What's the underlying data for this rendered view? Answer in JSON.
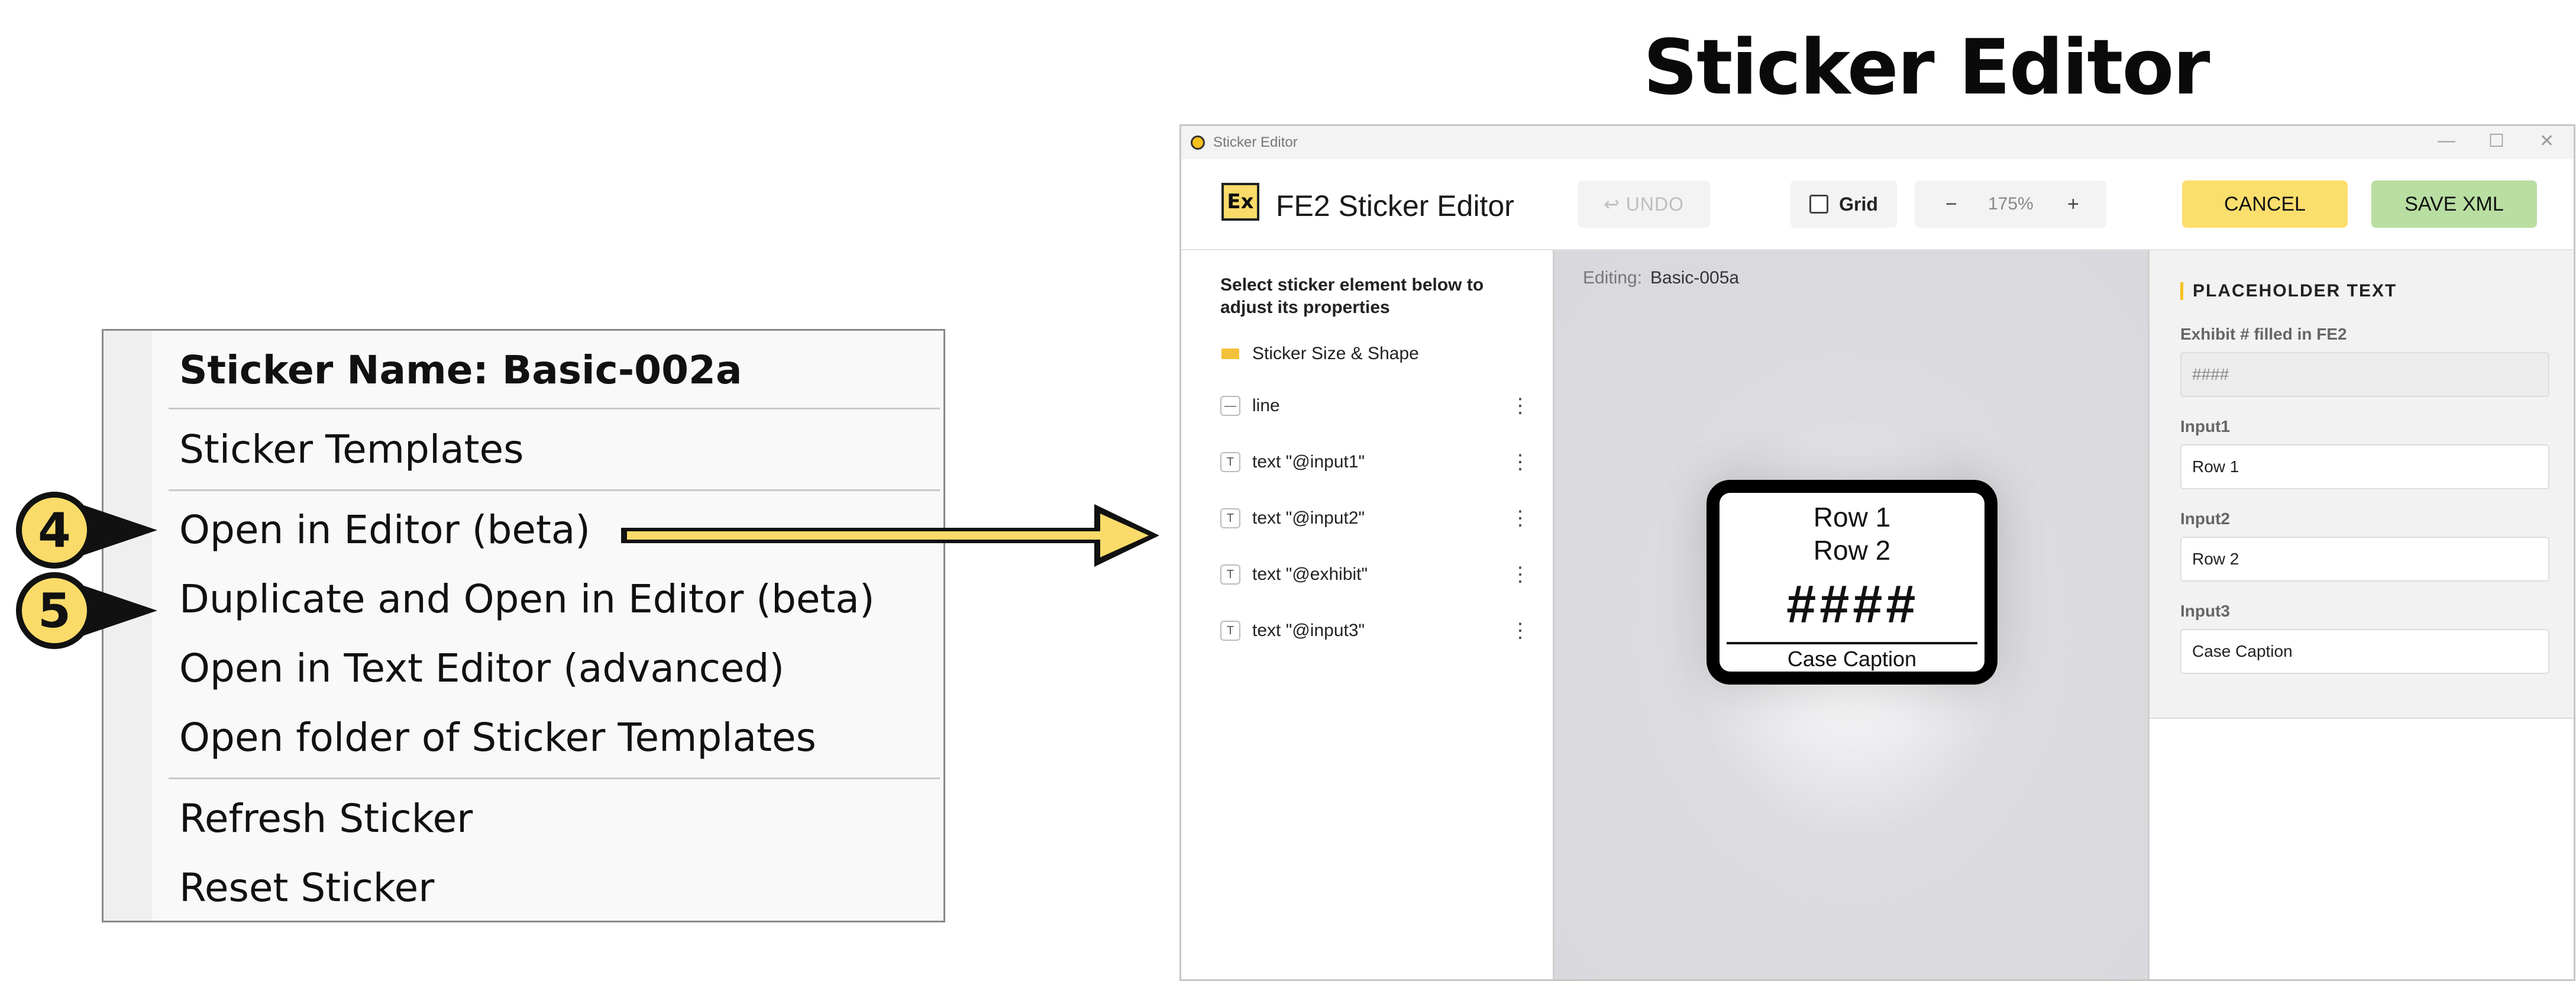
{
  "heading": "Sticker Editor",
  "context_menu": {
    "title": "Sticker Name: Basic-002a",
    "items": [
      "Sticker Templates",
      "Open in Editor (beta)",
      "Duplicate and Open in Editor (beta)",
      "Open in Text Editor (advanced)",
      "Open folder of Sticker Templates",
      "Refresh Sticker",
      "Reset Sticker"
    ]
  },
  "steps": [
    "4",
    "5"
  ],
  "window": {
    "title": "Sticker Editor",
    "controls": [
      "—",
      "☐",
      "✕"
    ],
    "logo": "Ex",
    "app_name": "FE2 Sticker Editor",
    "undo_label": "↩ UNDO",
    "grid_label": "Grid",
    "zoom": {
      "minus": "−",
      "value": "175%",
      "plus": "+"
    },
    "cancel_label": "CANCEL",
    "save_label": "SAVE XML"
  },
  "left_panel": {
    "instruction": "Select sticker element below to adjust its properties",
    "elements": [
      {
        "icon": "shape-icon",
        "label": "Sticker Size & Shape",
        "has_menu": false
      },
      {
        "icon": "line-icon",
        "icon_glyph": "—",
        "label": "line",
        "has_menu": true
      },
      {
        "icon": "text-icon",
        "icon_glyph": "T",
        "label": "text \"@input1\"",
        "has_menu": true
      },
      {
        "icon": "text-icon",
        "icon_glyph": "T",
        "label": "text \"@input2\"",
        "has_menu": true
      },
      {
        "icon": "text-icon",
        "icon_glyph": "T",
        "label": "text \"@exhibit\"",
        "has_menu": true
      },
      {
        "icon": "text-icon",
        "icon_glyph": "T",
        "label": "text \"@input3\"",
        "has_menu": true
      }
    ],
    "menu_glyph": "⋮"
  },
  "canvas": {
    "editing_label": "Editing:",
    "editing_value": "Basic-005a",
    "sticker": {
      "row1": "Row 1",
      "row2": "Row 2",
      "exhibit": "####",
      "caption": "Case Caption"
    }
  },
  "right_panel": {
    "section_title": "PLACEHOLDER TEXT",
    "fields": [
      {
        "label": "Exhibit # filled in FE2",
        "value": "####",
        "readonly": true
      },
      {
        "label": "Input1",
        "value": "Row 1",
        "readonly": false
      },
      {
        "label": "Input2",
        "value": "Row 2",
        "readonly": false
      },
      {
        "label": "Input3",
        "value": "Case Caption",
        "readonly": false
      }
    ]
  },
  "colors": {
    "accent_yellow": "#fbdf6d",
    "save_green": "#b8dea2",
    "badge_yellow": "#fadb6a"
  }
}
